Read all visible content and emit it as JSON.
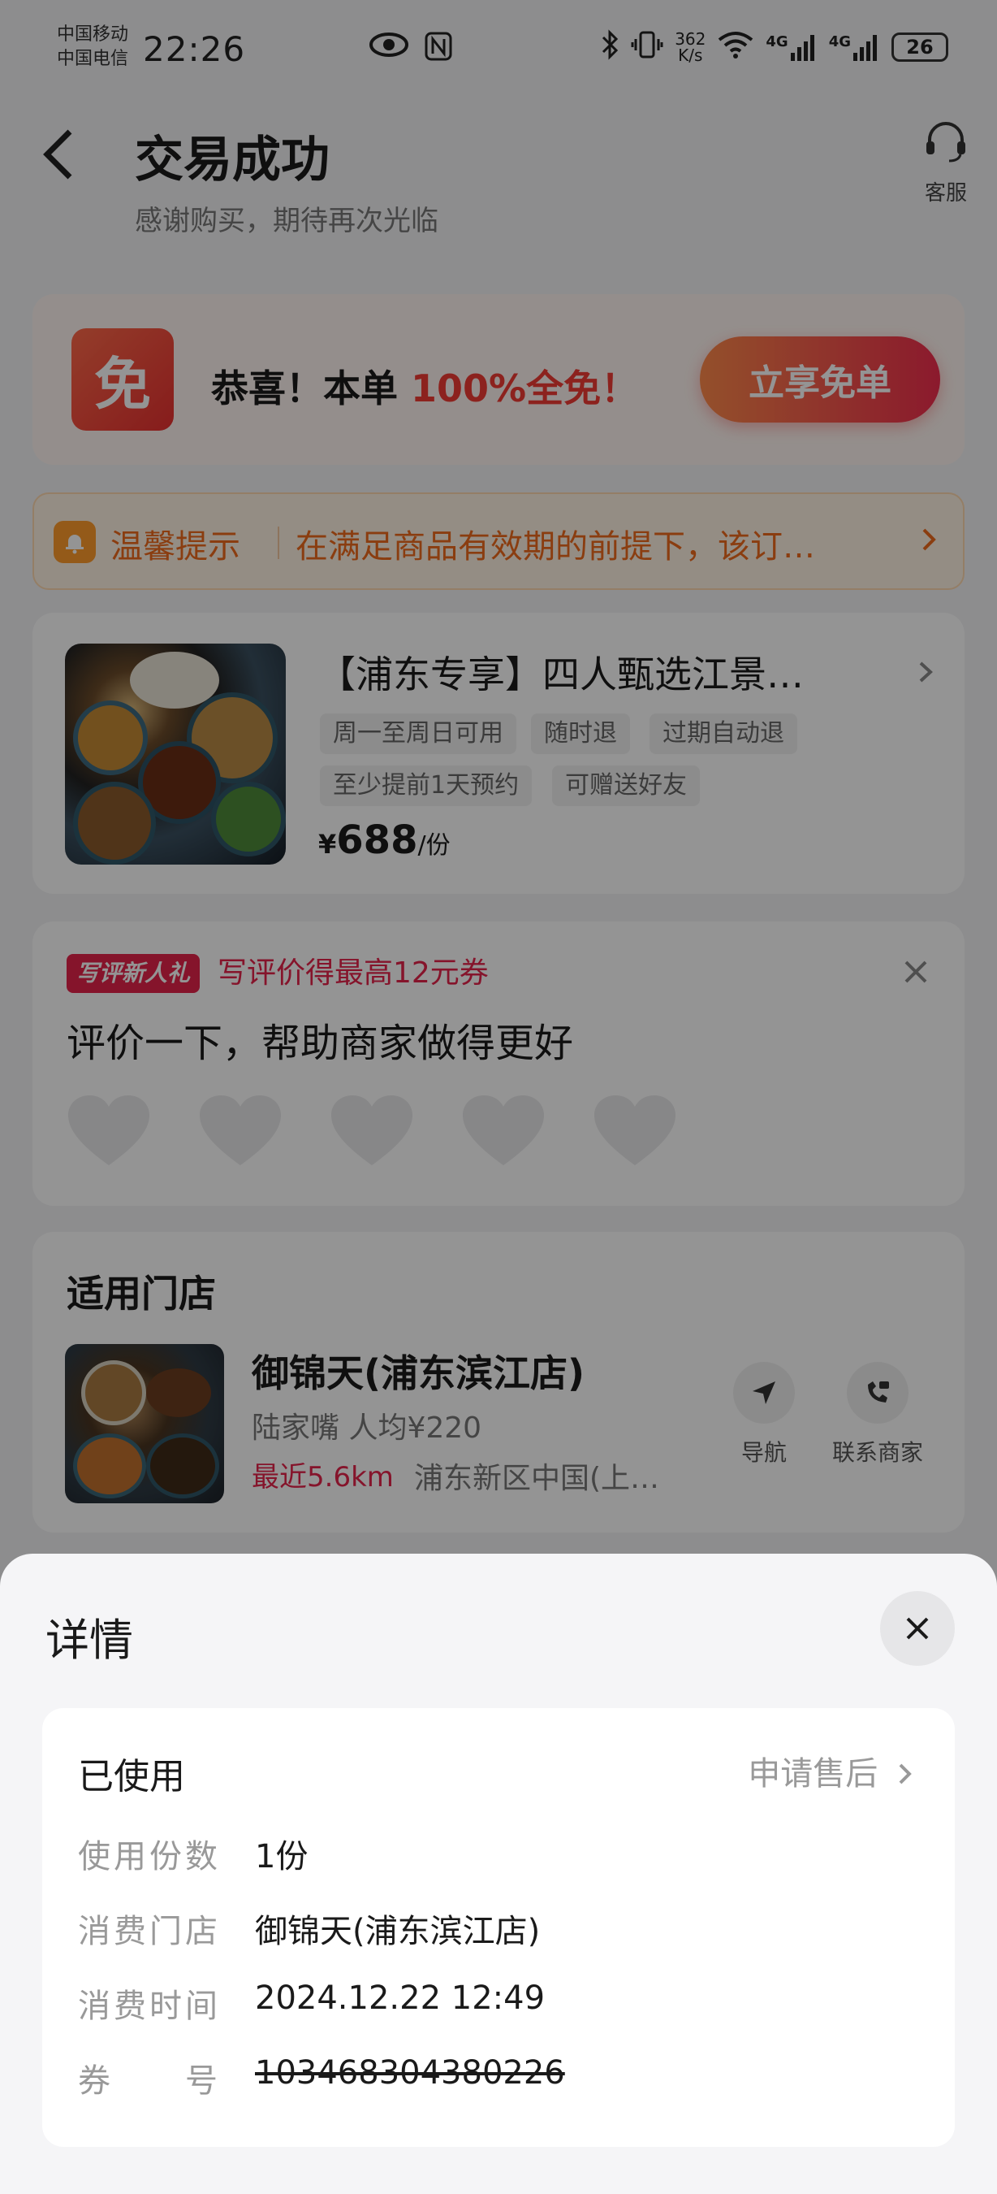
{
  "status_bar": {
    "carrier1": "中国移动",
    "carrier2": "中国电信",
    "time": "22:26",
    "net_speed_value": "362",
    "net_speed_unit": "K/s",
    "network1": "4G",
    "network2": "4G",
    "battery": "26"
  },
  "header": {
    "title": "交易成功",
    "subtitle": "感谢购买，期待再次光临",
    "customer_service": "客服"
  },
  "promo": {
    "icon_text": "免",
    "text_prefix": "恭喜！本单 ",
    "text_highlight": "100%全免！",
    "button": "立享免单",
    "colors": {
      "accent": "#f23c34"
    }
  },
  "notice": {
    "title": "温馨提示",
    "body": "在满足商品有效期的前提下，该订…"
  },
  "product": {
    "title": "【浦东专享】四人甄选江景…",
    "tags": [
      "周一至周日可用",
      "随时退",
      "过期自动退",
      "至少提前1天预约",
      "可赠送好友"
    ],
    "price_currency": "¥",
    "price": "688",
    "price_unit": "/份"
  },
  "review": {
    "badge": "写评新人礼",
    "promo": "写评价得最高12元券",
    "title": "评价一下，帮助商家做得更好",
    "rating_max": 5,
    "rating": 0
  },
  "store": {
    "heading": "适用门店",
    "name": "御锦天(浦东滨江店)",
    "area_price": "陆家嘴  人均¥220",
    "distance": "最近5.6km",
    "address": "浦东新区中国(上…",
    "nav_label": "导航",
    "contact_label": "联系商家"
  },
  "sheet": {
    "title": "详情",
    "status": "已使用",
    "after_sale": "申请售后",
    "rows": [
      {
        "label": "使用份数",
        "value": "1份"
      },
      {
        "label": "消费门店",
        "value": "御锦天(浦东滨江店)"
      },
      {
        "label": "消费时间",
        "value": "2024.12.22 12:49"
      },
      {
        "label": "券　　号",
        "value": "103468304380226"
      }
    ]
  }
}
